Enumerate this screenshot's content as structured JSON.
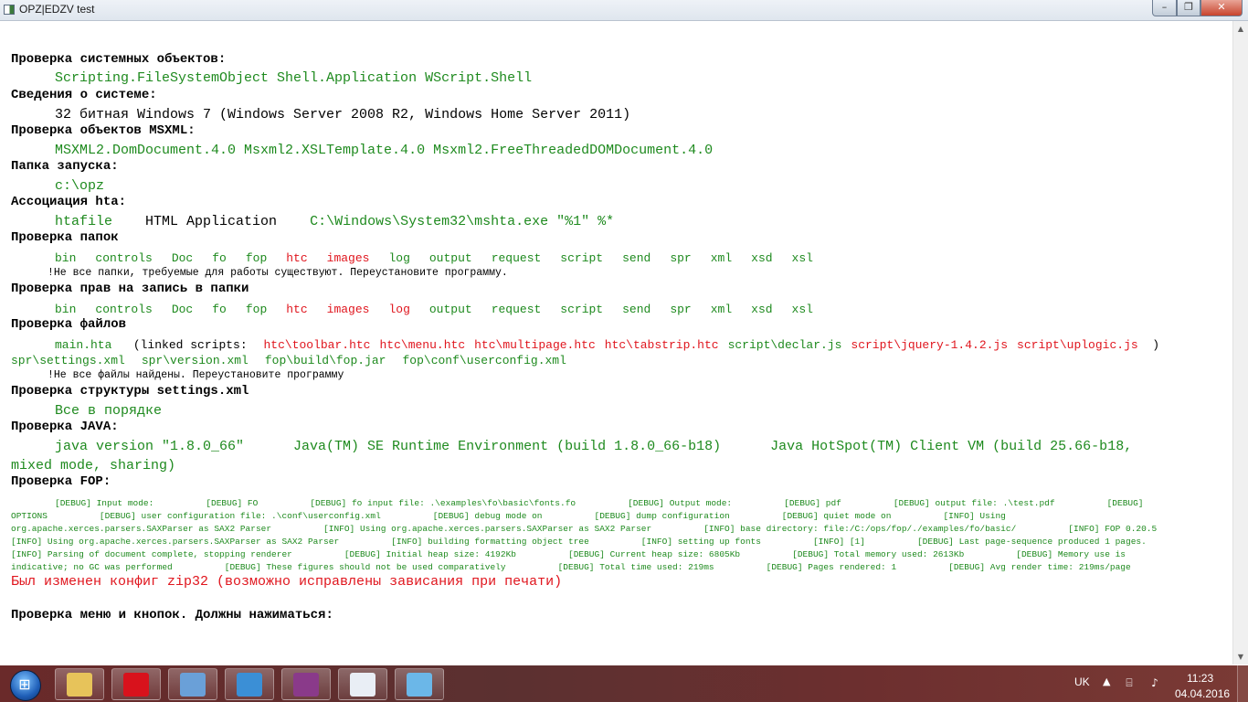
{
  "window": {
    "title": "OPZ|EDZV test",
    "minimize": "–",
    "maximize": "❐",
    "close": "✕"
  },
  "colors": {
    "heading": "#000000",
    "ok": "#1e8a1e",
    "error": "#e0161e"
  },
  "sections": {
    "sys_objects": {
      "title": "Проверка системных объектов:",
      "value": "Scripting.FileSystemObject Shell.Application WScript.Shell"
    },
    "sys_info": {
      "title": "Сведения о системе:",
      "value": "32 битная Windows 7 (Windows Server 2008 R2, Windows Home Server 2011)"
    },
    "msxml": {
      "title": "Проверка объектов MSXML:",
      "value": "MSXML2.DomDocument.4.0 Msxml2.XSLTemplate.4.0 Msxml2.FreeThreadedDOMDocument.4.0"
    },
    "launch_folder": {
      "title": "Папка запуска:",
      "value": "c:\\opz"
    },
    "hta": {
      "title": "Ассоциация hta:",
      "type": "htafile",
      "desc": "HTML Application",
      "cmd": "C:\\Windows\\System32\\mshta.exe \"%1\" %*"
    },
    "folders": {
      "title": "Проверка папок",
      "items": [
        {
          "name": "bin",
          "ok": true
        },
        {
          "name": "controls",
          "ok": true
        },
        {
          "name": "Doc",
          "ok": true
        },
        {
          "name": "fo",
          "ok": true
        },
        {
          "name": "fop",
          "ok": true
        },
        {
          "name": "htc",
          "ok": false
        },
        {
          "name": "images",
          "ok": false
        },
        {
          "name": "log",
          "ok": true
        },
        {
          "name": "output",
          "ok": true
        },
        {
          "name": "request",
          "ok": true
        },
        {
          "name": "script",
          "ok": true
        },
        {
          "name": "send",
          "ok": true
        },
        {
          "name": "spr",
          "ok": true
        },
        {
          "name": "xml",
          "ok": true
        },
        {
          "name": "xsd",
          "ok": true
        },
        {
          "name": "xsl",
          "ok": true
        }
      ],
      "warning": "!Не все папки, требуемые для работы существуют. Переустановите программу."
    },
    "write_rights": {
      "title": "Проверка прав на запись в папки",
      "items": [
        {
          "name": "bin",
          "ok": true
        },
        {
          "name": "controls",
          "ok": true
        },
        {
          "name": "Doc",
          "ok": true
        },
        {
          "name": "fo",
          "ok": true
        },
        {
          "name": "fop",
          "ok": true
        },
        {
          "name": "htc",
          "ok": false
        },
        {
          "name": "images",
          "ok": false
        },
        {
          "name": "log",
          "ok": false
        },
        {
          "name": "output",
          "ok": true
        },
        {
          "name": "request",
          "ok": true
        },
        {
          "name": "script",
          "ok": true
        },
        {
          "name": "send",
          "ok": true
        },
        {
          "name": "spr",
          "ok": true
        },
        {
          "name": "xml",
          "ok": true
        },
        {
          "name": "xsd",
          "ok": true
        },
        {
          "name": "xsl",
          "ok": true
        }
      ]
    },
    "files": {
      "title": "Проверка файлов",
      "main": "main.hta",
      "linked_open": "(linked scripts:",
      "scripts": [
        {
          "name": "htc\\toolbar.htc",
          "ok": false
        },
        {
          "name": "htc\\menu.htc",
          "ok": false
        },
        {
          "name": "htc\\multipage.htc",
          "ok": false
        },
        {
          "name": "htc\\tabstrip.htc",
          "ok": false
        },
        {
          "name": "script\\declar.js",
          "ok": true
        },
        {
          "name": "script\\jquery-1.4.2.js",
          "ok": false
        },
        {
          "name": "script\\uplogic.js",
          "ok": false
        }
      ],
      "linked_close": ")",
      "other": [
        "spr\\settings.xml",
        "spr\\version.xml",
        "fop\\build\\fop.jar",
        "fop\\conf\\userconfig.xml"
      ],
      "warning": "!Не все файлы найдены. Переустановите программу"
    },
    "settings": {
      "title": "Проверка структуры settings.xml",
      "value": "Все в порядке"
    },
    "java": {
      "title": "Проверка JAVA:",
      "line1": "java version \"1.8.0_66\"      Java(TM) SE Runtime Environment (build 1.8.0_66-b18)      Java HotSpot(TM) Client VM (build 25.66-b18,",
      "line2": "mixed mode, sharing)"
    },
    "fop": {
      "title": "Проверка FOP:",
      "lines": [
        "[DEBUG] Input mode:          [DEBUG] FO          [DEBUG] fo input file: .\\examples\\fo\\basic\\fonts.fo          [DEBUG] Output mode:          [DEBUG] pdf          [DEBUG] output file: .\\test.pdf          [DEBUG]",
        "OPTIONS          [DEBUG] user configuration file: .\\conf\\userconfig.xml          [DEBUG] debug mode on          [DEBUG] dump configuration          [DEBUG] quiet mode on          [INFO] Using",
        "org.apache.xerces.parsers.SAXParser as SAX2 Parser          [INFO] Using org.apache.xerces.parsers.SAXParser as SAX2 Parser          [INFO] base directory: file:/C:/ops/fop/./examples/fo/basic/          [INFO] FOP 0.20.5",
        "[INFO] Using org.apache.xerces.parsers.SAXParser as SAX2 Parser          [INFO] building formatting object tree          [INFO] setting up fonts          [INFO] [1]          [DEBUG] Last page-sequence produced 1 pages.",
        "[INFO] Parsing of document complete, stopping renderer          [DEBUG] Initial heap size: 4192Kb          [DEBUG] Current heap size: 6805Kb          [DEBUG] Total memory used: 2613Kb          [DEBUG] Memory use is",
        "indicative; no GC was performed          [DEBUG] These figures should not be used comparatively          [DEBUG] Total time used: 219ms          [DEBUG] Pages rendered: 1          [DEBUG] Avg render time: 219ms/page"
      ]
    },
    "zip_notice": "Был изменен конфиг zip32 (возможно исправлены зависания при печати)",
    "menu_check": {
      "title": "Проверка меню и кнопок. Должны нажиматься:"
    }
  },
  "taskbar": {
    "start_icon": "windows-start-orb",
    "apps": [
      {
        "name": "explorer-icon",
        "color": "#e7c35a"
      },
      {
        "name": "opera-icon",
        "color": "#d8121c"
      },
      {
        "name": "system-tools-icon",
        "color": "#6aa0d8"
      },
      {
        "name": "triangle-app-icon",
        "color": "#3b8fd6"
      },
      {
        "name": "winrar-icon",
        "color": "#8a3a8a"
      },
      {
        "name": "hta-window-icon",
        "color": "#e9eef5"
      },
      {
        "name": "paint-icon",
        "color": "#6bb7e8"
      }
    ],
    "tray": {
      "lang": "UK",
      "arrow": "▲",
      "time": "11:23",
      "date": "04.04.2016"
    }
  }
}
